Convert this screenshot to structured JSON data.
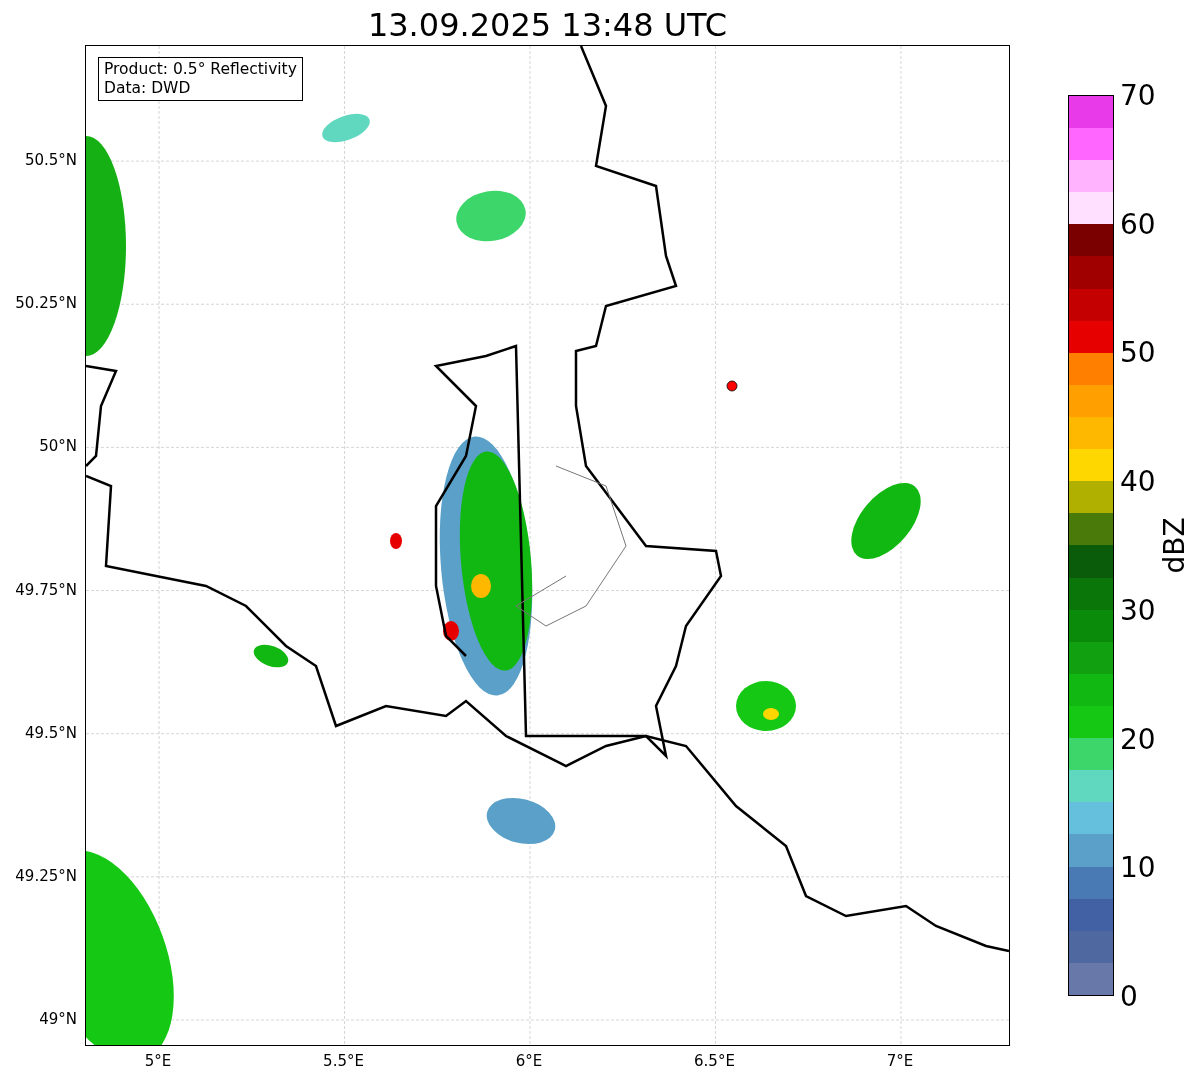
{
  "title": "13.09.2025 13:48 UTC",
  "info_box": [
    "Product: 0.5° Reflectivity",
    "Data: DWD"
  ],
  "y_ticks": [
    "50.5°N",
    "50.25°N",
    "50°N",
    "49.75°N",
    "49.5°N",
    "49.25°N",
    "49°N"
  ],
  "x_ticks": [
    "5°E",
    "5.5°E",
    "6°E",
    "6.5°E",
    "7°E"
  ],
  "colorbar": {
    "label": "dBZ",
    "ticks": [
      "70",
      "60",
      "50",
      "40",
      "30",
      "20",
      "10",
      "0"
    ],
    "steps": [
      {
        "color": "#6878a8"
      },
      {
        "color": "#5068a0"
      },
      {
        "color": "#4260a4"
      },
      {
        "color": "#4a7ab4"
      },
      {
        "color": "#5aa0c8"
      },
      {
        "color": "#64c0dc"
      },
      {
        "color": "#60d8c0"
      },
      {
        "color": "#3cd66a"
      },
      {
        "color": "#14c814"
      },
      {
        "color": "#12b812"
      },
      {
        "color": "#10a010"
      },
      {
        "color": "#0a8c0a"
      },
      {
        "color": "#0a760a"
      },
      {
        "color": "#0a5c0a"
      },
      {
        "color": "#4a7a0a"
      },
      {
        "color": "#b0b000"
      },
      {
        "color": "#ffd700"
      },
      {
        "color": "#ffb800"
      },
      {
        "color": "#ff9f00"
      },
      {
        "color": "#ff7f00"
      },
      {
        "color": "#e60000"
      },
      {
        "color": "#c40000"
      },
      {
        "color": "#a00000"
      },
      {
        "color": "#7a0000"
      },
      {
        "color": "#ffe0ff"
      },
      {
        "color": "#ffb3ff"
      },
      {
        "color": "#ff66ff"
      },
      {
        "color": "#e83ae8"
      }
    ]
  }
}
